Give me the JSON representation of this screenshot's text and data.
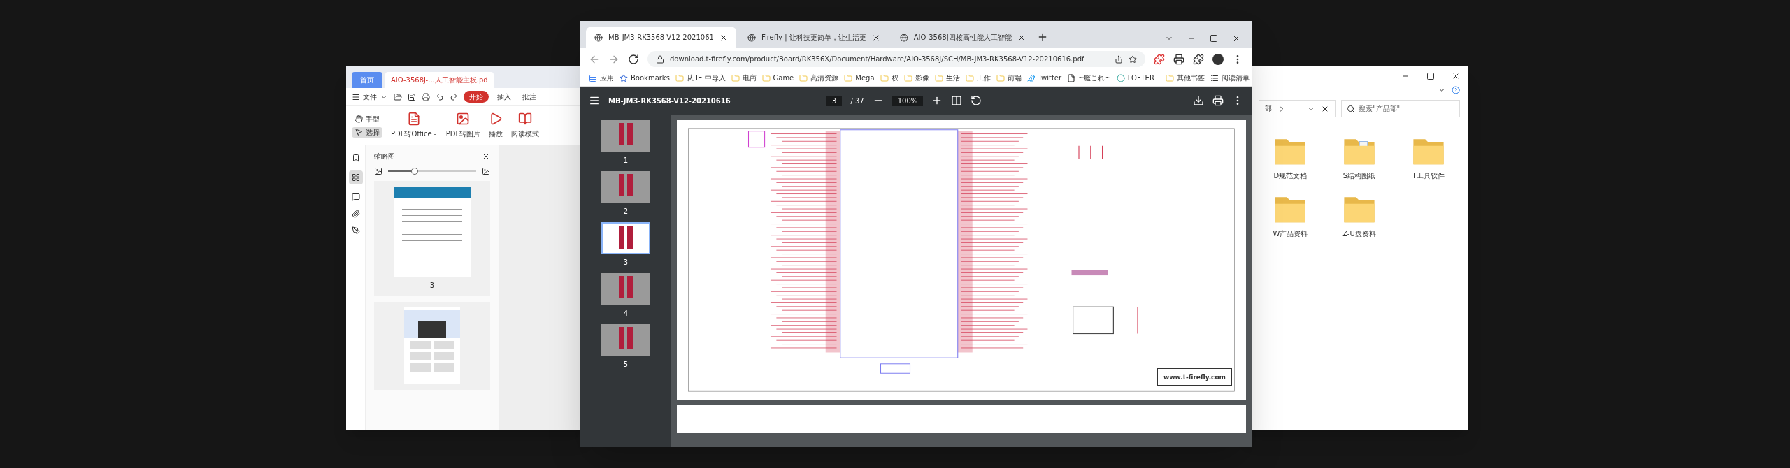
{
  "pdf_reader": {
    "tabs": [
      {
        "label": "首页",
        "selected": false
      },
      {
        "label": "AIO-3568J-...人工智能主板.pd",
        "selected": true
      }
    ],
    "menu": {
      "file": "文件",
      "tabs": [
        {
          "label": "开始",
          "selected": true
        },
        {
          "label": "插入",
          "selected": false
        },
        {
          "label": "批注",
          "selected": false
        }
      ]
    },
    "modes": [
      {
        "label": "手型",
        "kind": "hand",
        "selected": false
      },
      {
        "label": "选择",
        "kind": "select",
        "selected": true
      }
    ],
    "tools": [
      {
        "label": "PDF转Office",
        "kind": "office",
        "dropdown": true
      },
      {
        "label": "PDF转图片",
        "kind": "image",
        "dropdown": false
      },
      {
        "label": "播放",
        "kind": "play",
        "dropdown": false
      },
      {
        "label": "阅读模式",
        "kind": "read",
        "dropdown": false
      }
    ],
    "panel": {
      "title": "缩略图",
      "zoom": {
        "level": 0.3
      },
      "thumbnails": [
        {
          "label": "3",
          "kind": "contents"
        },
        {
          "kind": "product"
        }
      ]
    }
  },
  "browser": {
    "tabs": [
      {
        "title": "MB-JM3-RK3568-V12-2021061",
        "selected": true
      },
      {
        "title": "Firefly | 让科技更简单，让生活更",
        "selected": false
      },
      {
        "title": "AIO-3568J四核高性能人工智能",
        "selected": false
      }
    ],
    "address": "download.t-firefly.com/product/Board/RK356X/Document/Hardware/AIO-3568J/SCH/MB-JM3-RK3568-V12-20210616.pdf",
    "bookmarks": [
      {
        "label": "应用",
        "kind": "apps"
      },
      {
        "label": "Bookmarks",
        "kind": "star"
      },
      {
        "label": "从 IE 中导入",
        "kind": "folder"
      },
      {
        "label": "电商",
        "kind": "folder"
      },
      {
        "label": "Game",
        "kind": "folder"
      },
      {
        "label": "高清资源",
        "kind": "folder"
      },
      {
        "label": "Mega",
        "kind": "folder"
      },
      {
        "label": "权",
        "kind": "folder"
      },
      {
        "label": "影像",
        "kind": "folder"
      },
      {
        "label": "生活",
        "kind": "folder"
      },
      {
        "label": "工作",
        "kind": "folder"
      },
      {
        "label": "前端",
        "kind": "folder"
      },
      {
        "label": "Twitter",
        "kind": "bird"
      },
      {
        "label": "~艦これ~",
        "kind": "page"
      },
      {
        "label": "LOFTER",
        "kind": "circle"
      }
    ],
    "other_bookmarks": "其他书签",
    "reading_list": "阅读清单",
    "viewer": {
      "title": "MB-JM3-RK3568-V12-20210616",
      "page": "3",
      "page_total": "/ 37",
      "zoom": "100%",
      "thumbnails": [
        {
          "label": "1",
          "selected": false
        },
        {
          "label": "2",
          "selected": false
        },
        {
          "label": "3",
          "selected": true
        },
        {
          "label": "4",
          "selected": false
        },
        {
          "label": "5",
          "selected": false
        }
      ],
      "website": "www.t-firefly.com"
    }
  },
  "explorer": {
    "breadcrumb": "部",
    "search_placeholder": "搜索\"产品部\"",
    "folders": [
      {
        "name": "D规范文档",
        "kind": "plain"
      },
      {
        "name": "S结构图纸",
        "kind": "documents"
      },
      {
        "name": "T工具软件",
        "kind": "plain"
      },
      {
        "name": "W产品资料",
        "kind": "plain"
      },
      {
        "name": "Z-U盘资料",
        "kind": "plain"
      }
    ]
  }
}
